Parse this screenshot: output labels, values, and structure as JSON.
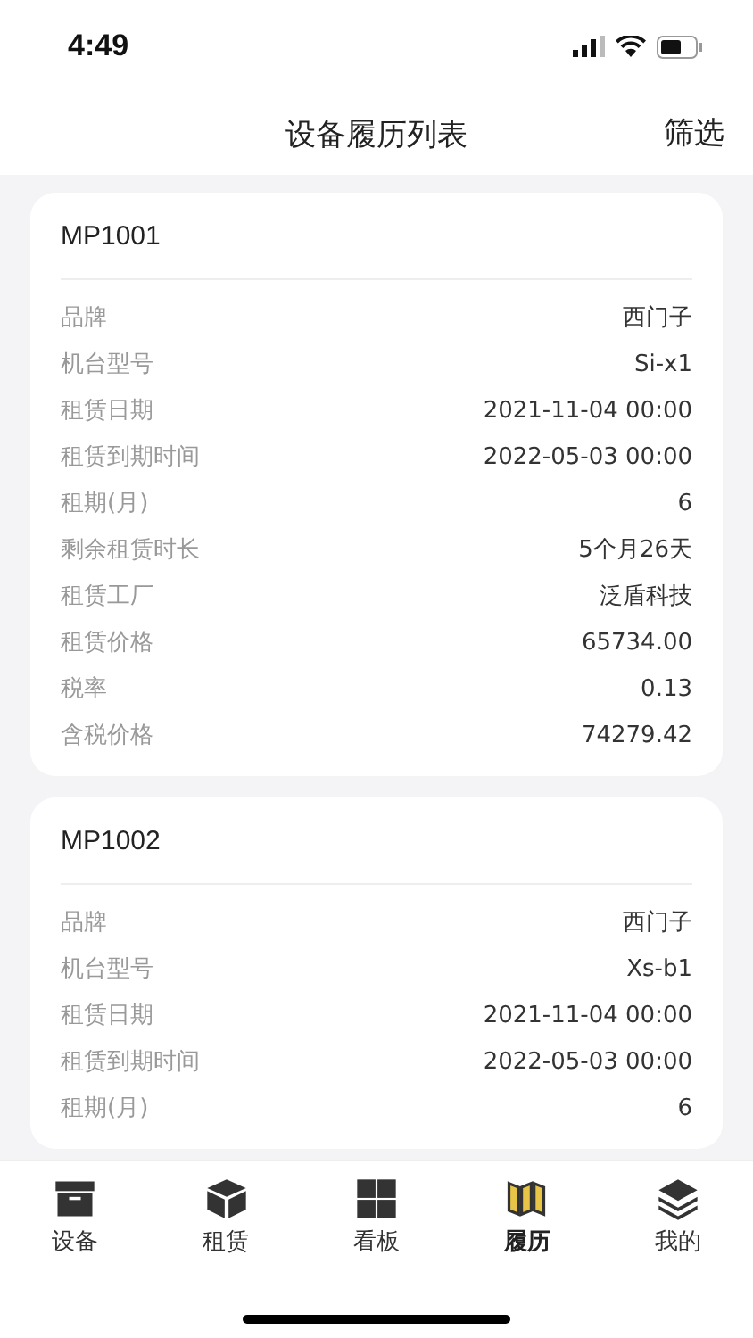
{
  "status_bar": {
    "time": "4:49"
  },
  "header": {
    "title": "设备履历列表",
    "action": "筛选"
  },
  "cards": [
    {
      "title": "MP1001",
      "rows": [
        {
          "label": "品牌",
          "value": "西门子"
        },
        {
          "label": "机台型号",
          "value": "Si-x1"
        },
        {
          "label": "租赁日期",
          "value": "2021-11-04 00:00"
        },
        {
          "label": "租赁到期时间",
          "value": "2022-05-03 00:00"
        },
        {
          "label": "租期(月)",
          "value": "6"
        },
        {
          "label": "剩余租赁时长",
          "value": "5个月26天"
        },
        {
          "label": "租赁工厂",
          "value": "泛盾科技"
        },
        {
          "label": "租赁价格",
          "value": "65734.00"
        },
        {
          "label": "税率",
          "value": "0.13"
        },
        {
          "label": "含税价格",
          "value": "74279.42"
        }
      ]
    },
    {
      "title": "MP1002",
      "rows": [
        {
          "label": "品牌",
          "value": "西门子"
        },
        {
          "label": "机台型号",
          "value": "Xs-b1"
        },
        {
          "label": "租赁日期",
          "value": "2021-11-04 00:00"
        },
        {
          "label": "租赁到期时间",
          "value": "2022-05-03 00:00"
        },
        {
          "label": "租期(月)",
          "value": "6"
        }
      ]
    }
  ],
  "tab_bar": [
    {
      "label": "设备",
      "kind": "archive",
      "selected": false
    },
    {
      "label": "租赁",
      "kind": "cube",
      "selected": false
    },
    {
      "label": "看板",
      "kind": "grid",
      "selected": false
    },
    {
      "label": "履历",
      "kind": "map",
      "selected": true
    },
    {
      "label": "我的",
      "kind": "layers",
      "selected": false
    }
  ]
}
